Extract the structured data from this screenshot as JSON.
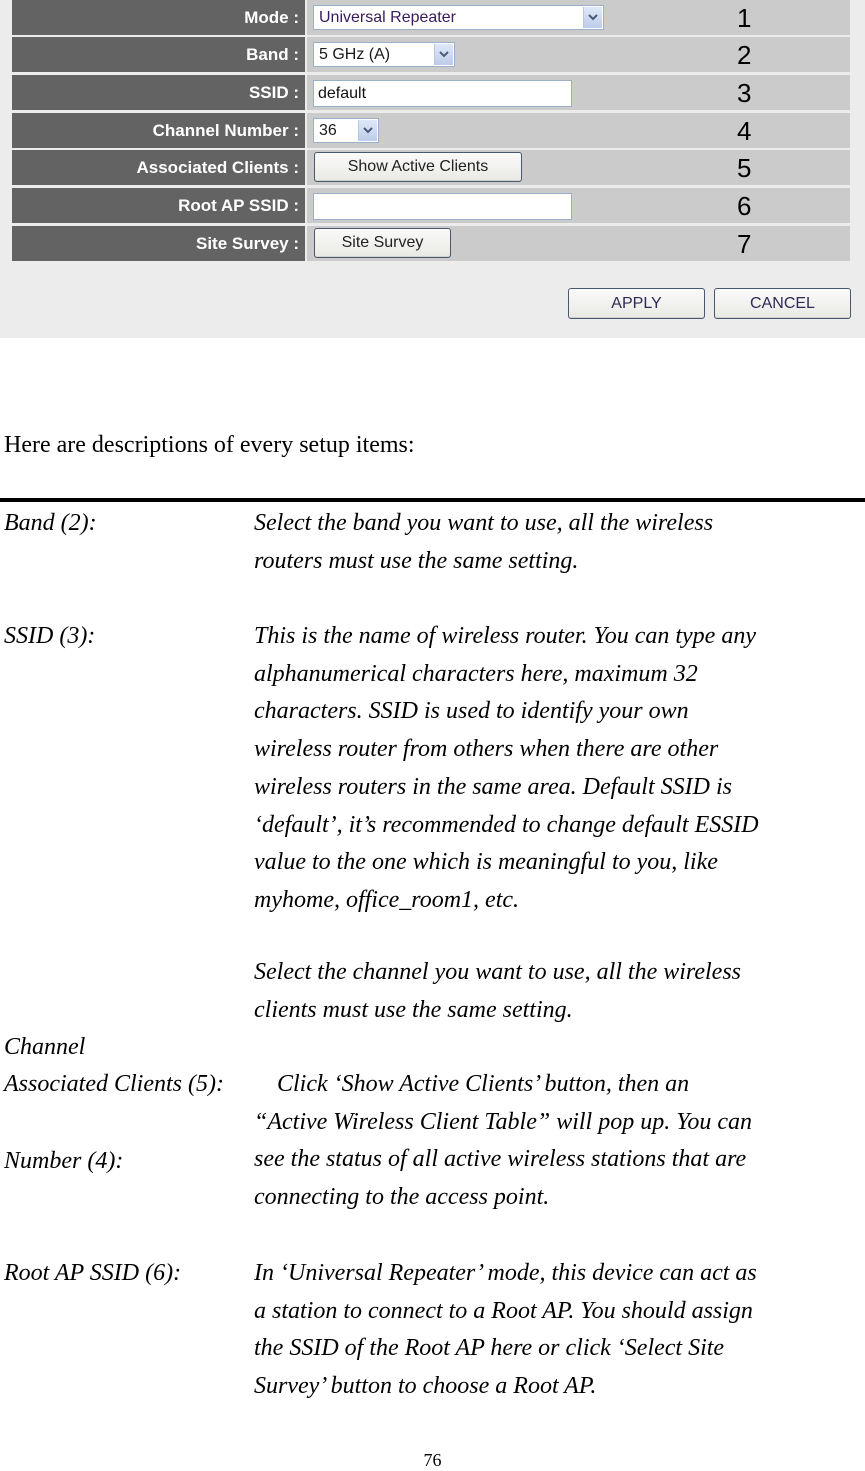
{
  "router_panel": {
    "rows": [
      {
        "label": "Mode :",
        "type": "select",
        "value": "Universal Repeater",
        "callout": "1"
      },
      {
        "label": "Band :",
        "type": "select",
        "value": "5 GHz (A)",
        "callout": "2"
      },
      {
        "label": "SSID :",
        "type": "text",
        "value": "default",
        "callout": "3"
      },
      {
        "label": "Channel Number :",
        "type": "select",
        "value": "36",
        "callout": "4"
      },
      {
        "label": "Associated Clients :",
        "type": "button",
        "value": "Show Active Clients",
        "callout": "5"
      },
      {
        "label": "Root AP SSID :",
        "type": "text",
        "value": "",
        "callout": "6"
      },
      {
        "label": "Site Survey :",
        "type": "button",
        "value": "Site Survey",
        "callout": "7"
      }
    ],
    "apply_label": "APPLY",
    "cancel_label": "CANCEL",
    "colors": {
      "label_bg": "#636363",
      "value_bg": "#cbcbcb",
      "panel_bg": "#ececec"
    }
  },
  "document": {
    "intro": "Here are descriptions of every setup items:",
    "items": [
      {
        "term": "Band (2):",
        "lines": [
          "Select the band you want to use, all the wireless",
          "routers must use the same setting."
        ]
      },
      {
        "term": "SSID (3):",
        "lines": [
          "This is the name of wireless router. You can type any",
          "alphanumerical characters here, maximum 32",
          "characters. SSID is used to identify your own",
          "wireless router from others when there are other",
          "wireless routers in the same area. Default SSID is",
          "‘default’, it’s recommended to change default ESSID",
          "value to the one which is meaningful to you, like",
          "myhome, office_room1, etc."
        ]
      },
      {
        "term_lines": [
          "Channel",
          "Number (4):"
        ],
        "lines": [
          "Select the channel you want to use, all the wireless",
          "clients must use the same setting."
        ]
      },
      {
        "term": "Associated Clients (5):",
        "lines": [
          "Click ‘Show Active Clients’ button, then an",
          "“Active Wireless Client Table” will pop up. You can",
          "see the status of all active wireless stations that are",
          "connecting to the access point."
        ]
      },
      {
        "term": "Root AP SSID (6):",
        "lines": [
          "In ‘Universal Repeater’ mode, this device can act as",
          "a station to connect to a Root AP. You should assign",
          "the SSID of the Root AP here or click ‘Select Site",
          "Survey’ button to choose a Root AP."
        ]
      }
    ],
    "page_number": "76"
  }
}
